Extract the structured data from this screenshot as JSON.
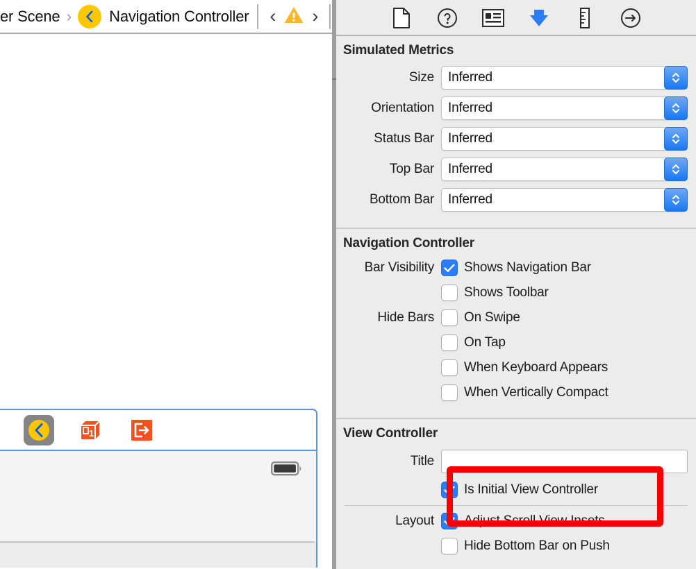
{
  "editor": {
    "breadcrumb": {
      "prev_crumb": "er Scene",
      "separator": "›",
      "scene_icon": "navigation-controller-icon",
      "current": "Navigation Controller"
    },
    "issue_nav": {
      "prev_label": "‹",
      "warning_icon": "warning-triangle-icon",
      "next_label": "›"
    },
    "scene": {
      "dock_icons": [
        {
          "name": "navigation-controller-icon",
          "selected": true
        },
        {
          "name": "first-responder-icon",
          "selected": false
        },
        {
          "name": "exit-icon",
          "selected": false
        }
      ],
      "status_bar_icon": "battery-icon"
    }
  },
  "inspector": {
    "tabs": [
      {
        "name": "file-inspector-tab",
        "icon": "document-icon",
        "selected": false
      },
      {
        "name": "quick-help-inspector-tab",
        "icon": "question-circle-icon",
        "selected": false
      },
      {
        "name": "identity-inspector-tab",
        "icon": "id-card-icon",
        "selected": false
      },
      {
        "name": "attributes-inspector-tab",
        "icon": "down-arrow-shield-icon",
        "selected": true
      },
      {
        "name": "size-inspector-tab",
        "icon": "ruler-icon",
        "selected": false
      },
      {
        "name": "connections-inspector-tab",
        "icon": "arrow-right-circle-icon",
        "selected": false
      }
    ],
    "accent_color": "#2b7df5",
    "highlight_color": "#f90000",
    "sections": {
      "simulated_metrics": {
        "title": "Simulated Metrics",
        "fields": [
          {
            "label": "Size",
            "value": "Inferred"
          },
          {
            "label": "Orientation",
            "value": "Inferred"
          },
          {
            "label": "Status Bar",
            "value": "Inferred"
          },
          {
            "label": "Top Bar",
            "value": "Inferred"
          },
          {
            "label": "Bottom Bar",
            "value": "Inferred"
          }
        ]
      },
      "navigation_controller": {
        "title": "Navigation Controller",
        "groups": [
          {
            "label": "Bar Visibility",
            "options": [
              {
                "text": "Shows Navigation Bar",
                "checked": true
              },
              {
                "text": "Shows Toolbar",
                "checked": false
              }
            ]
          },
          {
            "label": "Hide Bars",
            "options": [
              {
                "text": "On Swipe",
                "checked": false
              },
              {
                "text": "On Tap",
                "checked": false
              },
              {
                "text": "When Keyboard Appears",
                "checked": false
              },
              {
                "text": "When Vertically Compact",
                "checked": false
              }
            ]
          }
        ]
      },
      "view_controller": {
        "title": "View Controller",
        "title_field": {
          "label": "Title",
          "value": "",
          "placeholder": ""
        },
        "is_initial": {
          "text": "Is Initial View Controller",
          "checked": true
        },
        "layout": {
          "label": "Layout",
          "options": [
            {
              "text": "Adjust Scroll View Insets",
              "checked": true
            },
            {
              "text": "Hide Bottom Bar on Push",
              "checked": false
            }
          ]
        }
      }
    }
  }
}
